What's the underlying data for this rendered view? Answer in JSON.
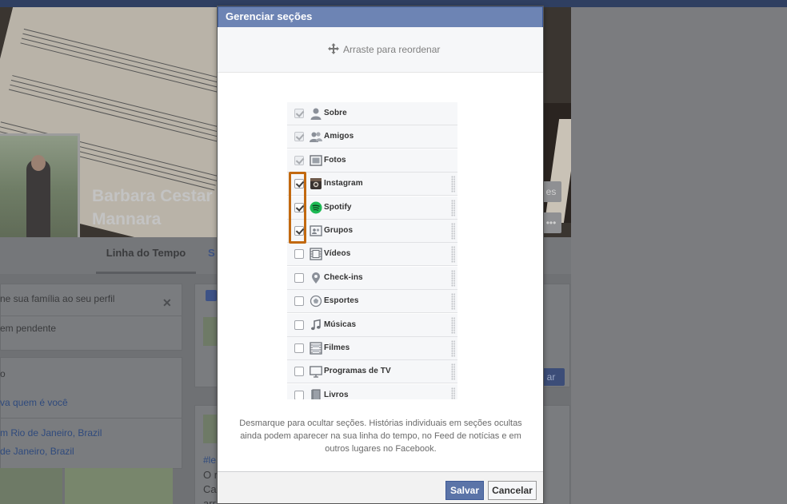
{
  "background_page": {
    "profile_name": "Barbara Cestar\nMannara",
    "tabs": {
      "timeline": "Linha do Tempo",
      "next_tab_fragment": "S"
    },
    "left_cards": {
      "family_prompt": "ne sua família ao seu perfil",
      "pending": "em pendente",
      "intro_fragment": "o",
      "who_are_you": "va quem é você",
      "lives_in": "m Rio de Janeiro, Brazil",
      "from": "de Janeiro, Brazil"
    },
    "right_cards": {
      "button_fragment": "ar",
      "hashtag_fragment": "#le",
      "post_line1": "O r",
      "post_line2": "Ca",
      "post_line3": "arr"
    },
    "cover_button_fragment": "es",
    "cover_more": "•••"
  },
  "modal": {
    "title": "Gerenciar seções",
    "drag_hint": "Arraste para reordenar",
    "sections": [
      {
        "label": "Sobre",
        "checked": true,
        "locked": true,
        "icon": "person-icon"
      },
      {
        "label": "Amigos",
        "checked": true,
        "locked": true,
        "icon": "friends-icon"
      },
      {
        "label": "Fotos",
        "checked": true,
        "locked": true,
        "icon": "photos-icon"
      },
      {
        "label": "Instagram",
        "checked": true,
        "locked": false,
        "icon": "instagram-icon"
      },
      {
        "label": "Spotify",
        "checked": true,
        "locked": false,
        "icon": "spotify-icon"
      },
      {
        "label": "Grupos",
        "checked": true,
        "locked": false,
        "icon": "groups-icon"
      },
      {
        "label": "Vídeos",
        "checked": false,
        "locked": false,
        "icon": "video-icon"
      },
      {
        "label": "Check-ins",
        "checked": false,
        "locked": false,
        "icon": "location-pin-icon"
      },
      {
        "label": "Esportes",
        "checked": false,
        "locked": false,
        "icon": "sports-icon"
      },
      {
        "label": "Músicas",
        "checked": false,
        "locked": false,
        "icon": "music-note-icon"
      },
      {
        "label": "Filmes",
        "checked": false,
        "locked": false,
        "icon": "film-icon"
      },
      {
        "label": "Programas de TV",
        "checked": false,
        "locked": false,
        "icon": "tv-icon"
      },
      {
        "label": "Livros",
        "checked": false,
        "locked": false,
        "icon": "book-icon"
      }
    ],
    "hint": "Desmarque para ocultar seções. Histórias individuais em seções ocultas ainda podem aparecer na sua linha do tempo, no Feed de notícias e em outros lugares no Facebook.",
    "save_label": "Salvar",
    "cancel_label": "Cancelar"
  },
  "colors": {
    "header_blue": "#6d84b4",
    "save_blue": "#5b74a8",
    "highlight_orange": "#c2690f",
    "spotify_green": "#1db954"
  }
}
